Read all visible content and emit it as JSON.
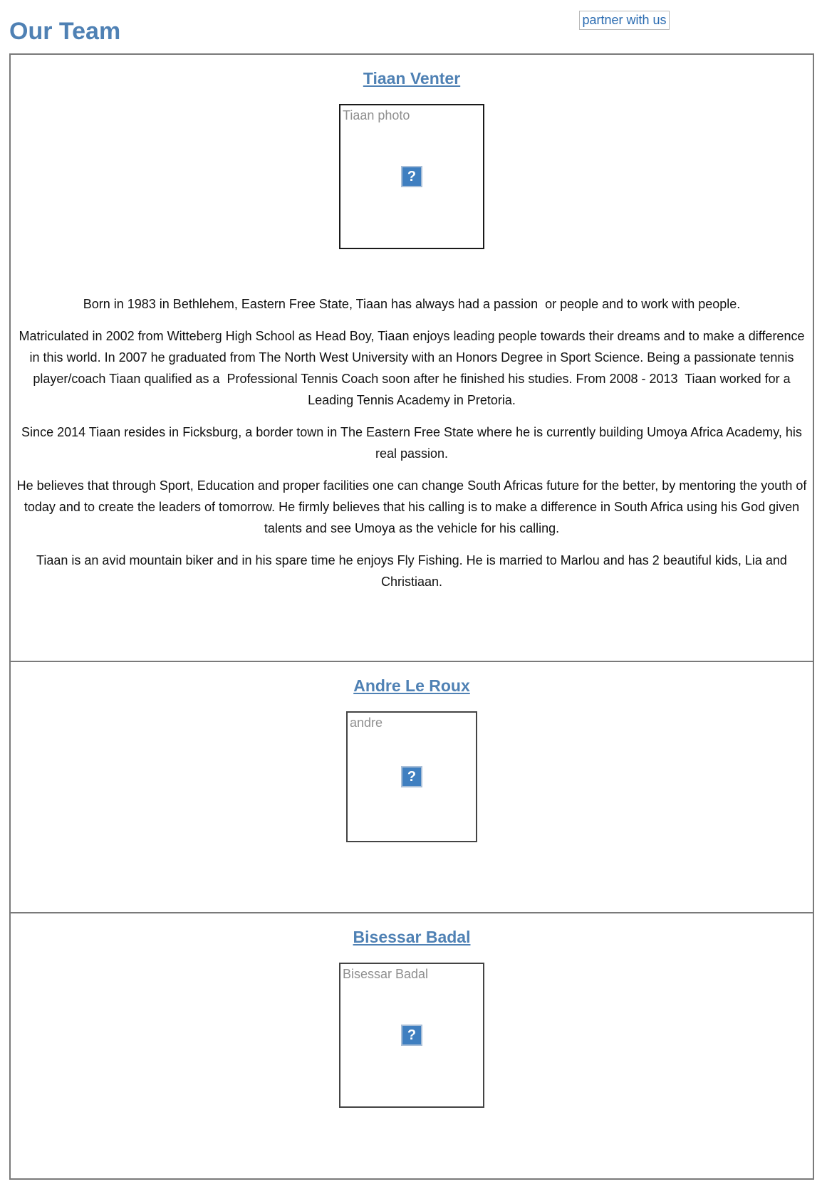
{
  "header": {
    "title": "Our Team",
    "partner_link": "partner with us"
  },
  "icons": {
    "broken_image": "broken-image-icon"
  },
  "colors": {
    "accent": "#4f81b4",
    "link": "#2a6bb1",
    "border": "#7a7a7a"
  },
  "members": [
    {
      "name": "Tiaan Venter",
      "photo_alt": "Tiaan photo",
      "bio": [
        "Born in 1983 in Bethlehem, Eastern Free State, Tiaan has always had a passion  or people and to work with people.",
        "Matriculated in 2002 from Witteberg High School as Head Boy, Tiaan enjoys leading people towards their dreams and to make a difference in this world. In 2007 he graduated from The North West University with an Honors Degree in Sport Science. Being a passionate tennis player/coach Tiaan qualified as a  Professional Tennis Coach soon after he finished his studies. From 2008 - 2013  Tiaan worked for a Leading Tennis Academy in Pretoria.",
        "Since 2014 Tiaan resides in Ficksburg, a border town in The Eastern Free State where he is currently building Umoya Africa Academy, his real passion.",
        "He believes that through Sport, Education and proper facilities one can change South Africas future for the better, by mentoring the youth of today and to create the leaders of tomorrow. He firmly believes that his calling is to make a difference in South Africa using his God given talents and see Umoya as the vehicle for his calling.",
        "Tiaan is an avid mountain biker and in his spare time he enjoys Fly Fishing. He is married to Marlou and has 2 beautiful kids, Lia and Christiaan."
      ]
    },
    {
      "name": "Andre Le Roux",
      "photo_alt": "andre"
    },
    {
      "name": "Bisessar Badal",
      "photo_alt": "Bisessar Badal"
    }
  ]
}
